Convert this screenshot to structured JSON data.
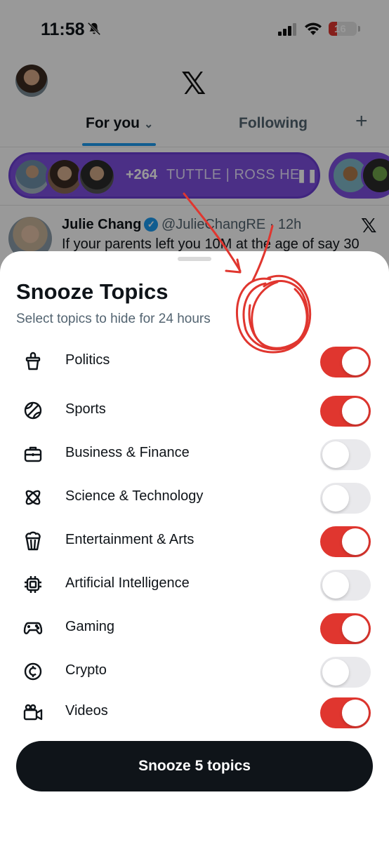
{
  "status_bar": {
    "time": "11:58",
    "battery": "16"
  },
  "header": {
    "logo": "𝕏"
  },
  "tabs": {
    "for_you": "For you",
    "following": "Following",
    "add": "+"
  },
  "spaces": {
    "count": "+264",
    "title": "TUTTLE  | ROSS HE",
    "pause": "❚❚"
  },
  "tweet": {
    "name": "Julie Chang",
    "handle": "@JulieChangRE · 12h",
    "text": "If your parents left you 10M at the age of say 30",
    "close": "𝕏"
  },
  "sheet": {
    "title": "Snooze Topics",
    "subtitle": "Select topics to hide for 24 hours",
    "topics": [
      {
        "label": "Politics",
        "icon": "podium-icon",
        "on": true
      },
      {
        "label": "Sports",
        "icon": "ball-icon",
        "on": true
      },
      {
        "label": "Business & Finance",
        "icon": "briefcase-icon",
        "on": false
      },
      {
        "label": "Science & Technology",
        "icon": "atom-icon",
        "on": false
      },
      {
        "label": "Entertainment & Arts",
        "icon": "popcorn-icon",
        "on": true
      },
      {
        "label": "Artificial Intelligence",
        "icon": "chip-icon",
        "on": false
      },
      {
        "label": "Gaming",
        "icon": "gamepad-icon",
        "on": true
      },
      {
        "label": "Crypto",
        "icon": "crypto-coin-icon",
        "on": false
      },
      {
        "label": "Videos",
        "icon": "video-camera-icon",
        "on": true
      }
    ],
    "button": "Snooze 5 topics"
  },
  "colors": {
    "toggle_on": "#e0362f",
    "toggle_off": "#e9e9ec",
    "accent": "#1d9bf0",
    "spaces": "#7d4fe0"
  }
}
